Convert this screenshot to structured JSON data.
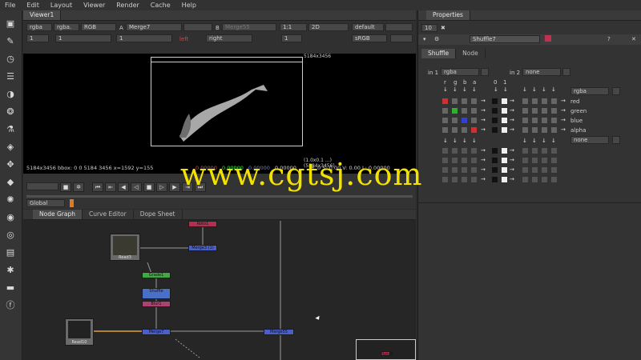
{
  "menu": [
    "File",
    "Edit",
    "Layout",
    "Viewer",
    "Render",
    "Cache",
    "Help"
  ],
  "viewer": {
    "tab": "Viewer1",
    "controls": {
      "layer_a": "rgba",
      "layer_b": "rgba.",
      "channel": "RGB",
      "a_label": "A",
      "a_input": "Merge7",
      "b_label": "B",
      "b_input": "Merge55",
      "zoom": "1:1",
      "mode": "2D",
      "lut": "default",
      "frame": "1",
      "gamma": "1",
      "gain": "1",
      "roi_toggle": "left",
      "view": "right",
      "fps": "1",
      "colorspace": "sRGB"
    },
    "format_label": "5184x3456",
    "bbox_label": "(1.0x0.1 ...)\n(5184x3456)",
    "status_left": "5184x3456 bbox: 0 0 5184 3456 x=1592 y=155",
    "status_rgba": [
      "0.00000",
      "0.00000",
      "0.00000",
      "0.00000"
    ],
    "status_right": "H: 0 S: 0.00 V: 0.00 L: 0.00000",
    "timeline_range": "Global"
  },
  "nodegraph": {
    "tabs": [
      "Node Graph",
      "Curve Editor",
      "Dope Sheet"
    ],
    "nodes": [
      {
        "label": "Roto1",
        "color": "#b03050"
      },
      {
        "label": "Merge3 (1)",
        "color": "#4a5fc8"
      },
      {
        "label": "Read3",
        "color": "#777"
      },
      {
        "label": "Grade1",
        "color": "#3faa3f"
      },
      {
        "label": "Shuffle",
        "color": "#4a6fc8"
      },
      {
        "label": "Blur1",
        "color": "#b04070"
      },
      {
        "label": "Merge7",
        "color": "#4a5fc8"
      },
      {
        "label": "Merge55",
        "color": "#4a5fc8"
      },
      {
        "label": "Read10",
        "color": "#777"
      },
      {
        "label": "Roto2",
        "color": "#b03050"
      }
    ]
  },
  "properties": {
    "title": "Properties",
    "max_panels": "10",
    "node_name": "Shuffle7",
    "tabs": [
      "Shuffle",
      "Node"
    ],
    "in1_label": "in 1",
    "in1_value": "rgba",
    "in2_label": "in 2",
    "in2_value": "none",
    "cols_in": [
      "r",
      "g",
      "b",
      "a"
    ],
    "cols_in2": [
      "0",
      "1"
    ],
    "out_value": "rgba",
    "out2_value": "none",
    "channels": [
      "red",
      "green",
      "blue",
      "alpha"
    ]
  },
  "watermark": "www.cgtsj.com"
}
